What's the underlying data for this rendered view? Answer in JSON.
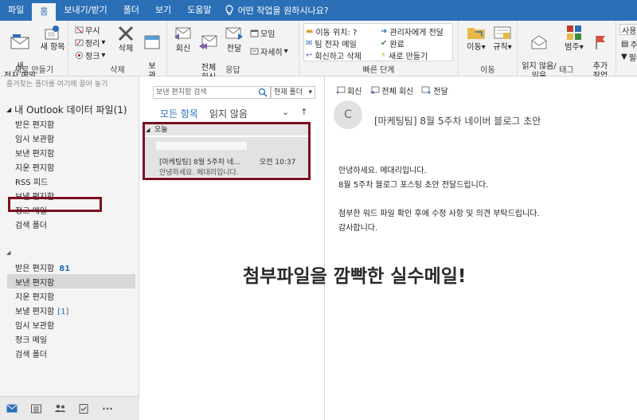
{
  "tabs": [
    "파일",
    "홈",
    "보내기/받기",
    "폴더",
    "보기",
    "도움말"
  ],
  "tell_me": "어떤 작업을 원하시나요?",
  "ribbon": {
    "new_group": {
      "new_mail": "새\n전자 메일",
      "new_items": "새 항목",
      "label": "새로 만들기"
    },
    "delete_group": {
      "ignore": "무시",
      "cleanup": "정리",
      "junk": "정크",
      "delete": "삭제",
      "archive": "보\n관",
      "label": "삭제"
    },
    "respond_group": {
      "reply": "회신",
      "reply_all": "전체\n회신",
      "forward": "전달",
      "meeting": "모임",
      "more": "자세히",
      "label": "응답"
    },
    "quicksteps": {
      "items": [
        "이동 위치: ?",
        "관리자에게 전달",
        "팀 전자 메일",
        "완료",
        "회신하고 삭제",
        "새로 만들기"
      ],
      "label": "빠른 단계"
    },
    "move_group": {
      "move": "이동",
      "rules": "규칙",
      "label": "이동"
    },
    "tags_group": {
      "read_unread": "읽지 않음/\n읽음",
      "categorize": "범주",
      "followup": "추가\n작업",
      "label": "태그"
    },
    "find": {
      "search_people": "사용자 검색",
      "address_book": "주소 록",
      "filter": "필터"
    }
  },
  "left": {
    "drag_hint": "즐겨찾는 폴더를 여기에 끌어 놓기",
    "account": "내 Outlook 데이터 파일(1)",
    "folders1": [
      "받은 편지함",
      "임시 보관함",
      "보낸 편지함",
      "지운 편지함",
      "RSS 피드",
      "보낼 편지함",
      "정크 메일",
      "검색 폴더"
    ],
    "folders2": [
      {
        "name": "받은 편지함",
        "count": "81"
      },
      {
        "name": "보낸 편지함",
        "count": ""
      },
      {
        "name": "지운 편지함",
        "count": ""
      },
      {
        "name": "보낼 편지함",
        "count": "[1]"
      },
      {
        "name": "임시 보관함",
        "count": ""
      },
      {
        "name": "정크 메일",
        "count": ""
      },
      {
        "name": "검색 폴더",
        "count": ""
      }
    ],
    "nav": [
      "mail-icon",
      "calendar-icon",
      "people-icon",
      "tasks-icon",
      "more-icon"
    ]
  },
  "list": {
    "search_placeholder": "보낸 편지함 검색",
    "scope": "현재 폴더",
    "filter_all": "모든 항목",
    "filter_unread": "읽지 않음",
    "group_today": "오늘",
    "item": {
      "subject": "[마케팅팀] 8월 5주차 네...",
      "time": "오전 10:37",
      "preview": "안녕하세요. 메대리입니다."
    }
  },
  "reading": {
    "actions": [
      "회신",
      "전체 회신",
      "전달"
    ],
    "avatar": "C",
    "subject": "[마케팅팀] 8월 5주차 네이버 블로그 초안",
    "body": [
      "안녕하세요. 메대리입니다.",
      "8월 5주차 블로그 포스팅 초안 전달드립니다.",
      "",
      "첨부한 워드 파일 확인 후에 수정 사항 및 의견 부탁드립니다.",
      "감사합니다."
    ]
  },
  "overlay_caption": "첨부파일을 깜빡한 실수메일!",
  "colors": {
    "accent": "#2b6fb6",
    "highlight_box": "#7a1020"
  }
}
